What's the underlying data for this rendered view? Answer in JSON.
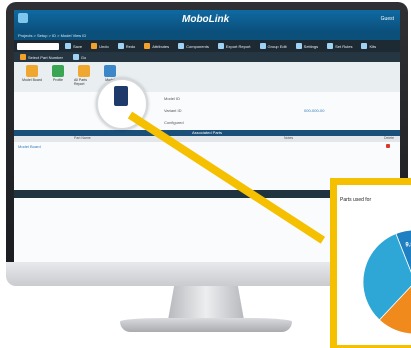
{
  "app": {
    "logo": "MoboLink",
    "user": "Guest"
  },
  "breadcrumb": "Projects > Setup > ID > Model View ID",
  "toolbar": {
    "select_value": "All",
    "items": [
      "Save",
      "Undo",
      "Redo",
      "Attributes",
      "Components",
      "Export Report",
      "Group Edit",
      "Settings",
      "Set Rules",
      "Kits",
      "Import",
      "Layout"
    ]
  },
  "toolbar2": {
    "left": "Select Part Number",
    "right": "Go"
  },
  "ribbon": [
    "Model Board",
    "Profile",
    "All Parts Report",
    "Model"
  ],
  "form": {
    "label1": "Model ID",
    "label2": "Variant ID",
    "label3": "Configured",
    "value2": "000-000-00"
  },
  "table": {
    "band_title": "Associated Parts",
    "headers": [
      "Part Name",
      "Item",
      "Qty",
      "Notes",
      "Delete"
    ],
    "row1": "Model Board"
  },
  "chart_data": {
    "type": "pie",
    "title": "Parts used for",
    "values_pct": [
      9.8,
      5.3,
      4.9
    ],
    "labels": [
      "9.8%",
      "5.3%",
      "4.9%"
    ],
    "colors": [
      "#1e7fc2",
      "#8b1c8f",
      "#3aa552",
      "#f08a1c",
      "#2fa7d6"
    ]
  }
}
